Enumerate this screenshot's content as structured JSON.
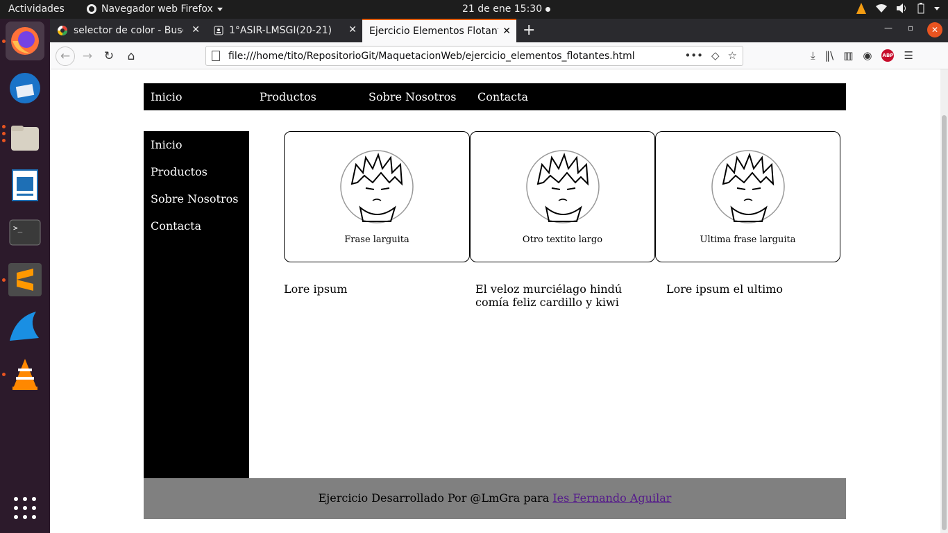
{
  "system_bar": {
    "activities": "Actividades",
    "app_name": "Navegador web Firefox",
    "clock": "21 de ene  15:30"
  },
  "browser": {
    "tabs": [
      {
        "label": "selector de color - Buscar",
        "active": false
      },
      {
        "label": "1°ASIR-LMSGI(20-21)",
        "active": false
      },
      {
        "label": "Ejercicio Elementos Flotantes",
        "active": true
      }
    ],
    "url": "file:///home/tito/RepositorioGit/MaquetacionWeb/ejercicio_elementos_flotantes.html"
  },
  "page": {
    "top_nav": [
      "Inicio",
      "Productos",
      "Sobre Nosotros",
      "Contacta"
    ],
    "side_nav": [
      "Inicio",
      "Productos",
      "Sobre Nosotros",
      "Contacta"
    ],
    "cards": [
      {
        "caption": "Frase larguita"
      },
      {
        "caption": "Otro textito largo"
      },
      {
        "caption": "Ultima frase larguita"
      }
    ],
    "paragraphs": [
      "Lore ipsum",
      "El veloz murciélago hindú comía feliz cardillo y kiwi",
      "Lore ipsum el ultimo"
    ],
    "footer": {
      "text": "Ejercicio Desarrollado Por @LmGra para ",
      "link": "Ies Fernando Aguilar"
    }
  }
}
